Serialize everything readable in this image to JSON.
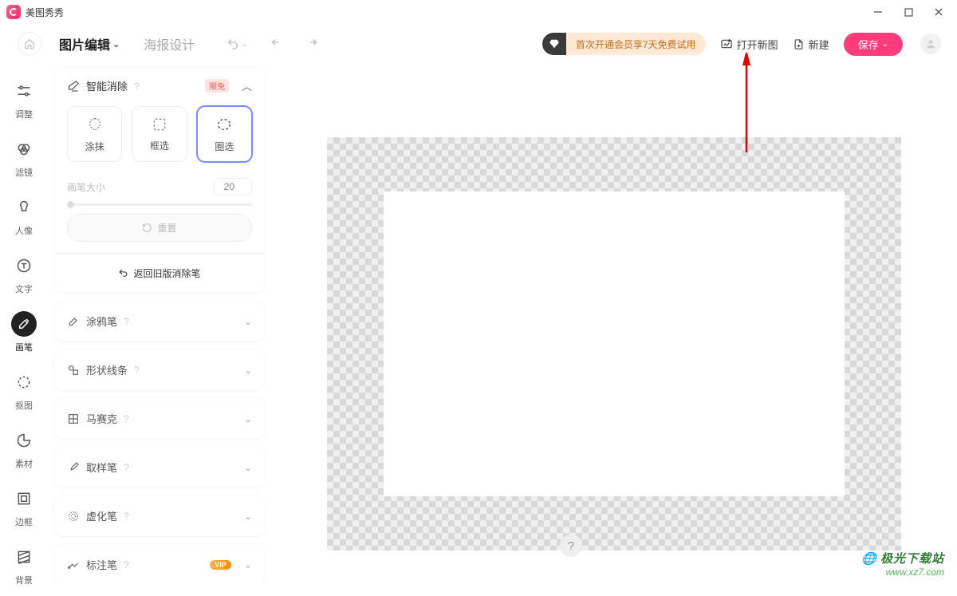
{
  "app": {
    "name": "美图秀秀"
  },
  "header": {
    "mode_edit": "图片编辑",
    "mode_poster": "海报设计",
    "promo_text": "首次开通会员享7天免费试用",
    "open_image": "打开新图",
    "new_doc": "新建",
    "save": "保存"
  },
  "rail": {
    "adjust": "调整",
    "filter": "滤镜",
    "portrait": "人像",
    "text": "文字",
    "brush": "画笔",
    "cutout": "抠图",
    "material": "素材",
    "frame": "边框",
    "background": "背景"
  },
  "panel": {
    "smart_erase": {
      "title": "智能消除",
      "badge": "限免"
    },
    "tools": {
      "brush": "涂抹",
      "rect": "框选",
      "lasso": "圈选"
    },
    "brush_size": {
      "label": "画笔大小",
      "value": 20
    },
    "reset": "重置",
    "back_old": "返回旧版消除笔",
    "acc": {
      "doodle": "涂鸦笔",
      "shape": "形状线条",
      "mosaic": "马赛克",
      "sampler": "取样笔",
      "blur": "虚化笔",
      "annotate": "标注笔",
      "vip": "VIP"
    }
  },
  "watermark": {
    "line1": "极光下载站",
    "line2": "www.xz7.com"
  }
}
